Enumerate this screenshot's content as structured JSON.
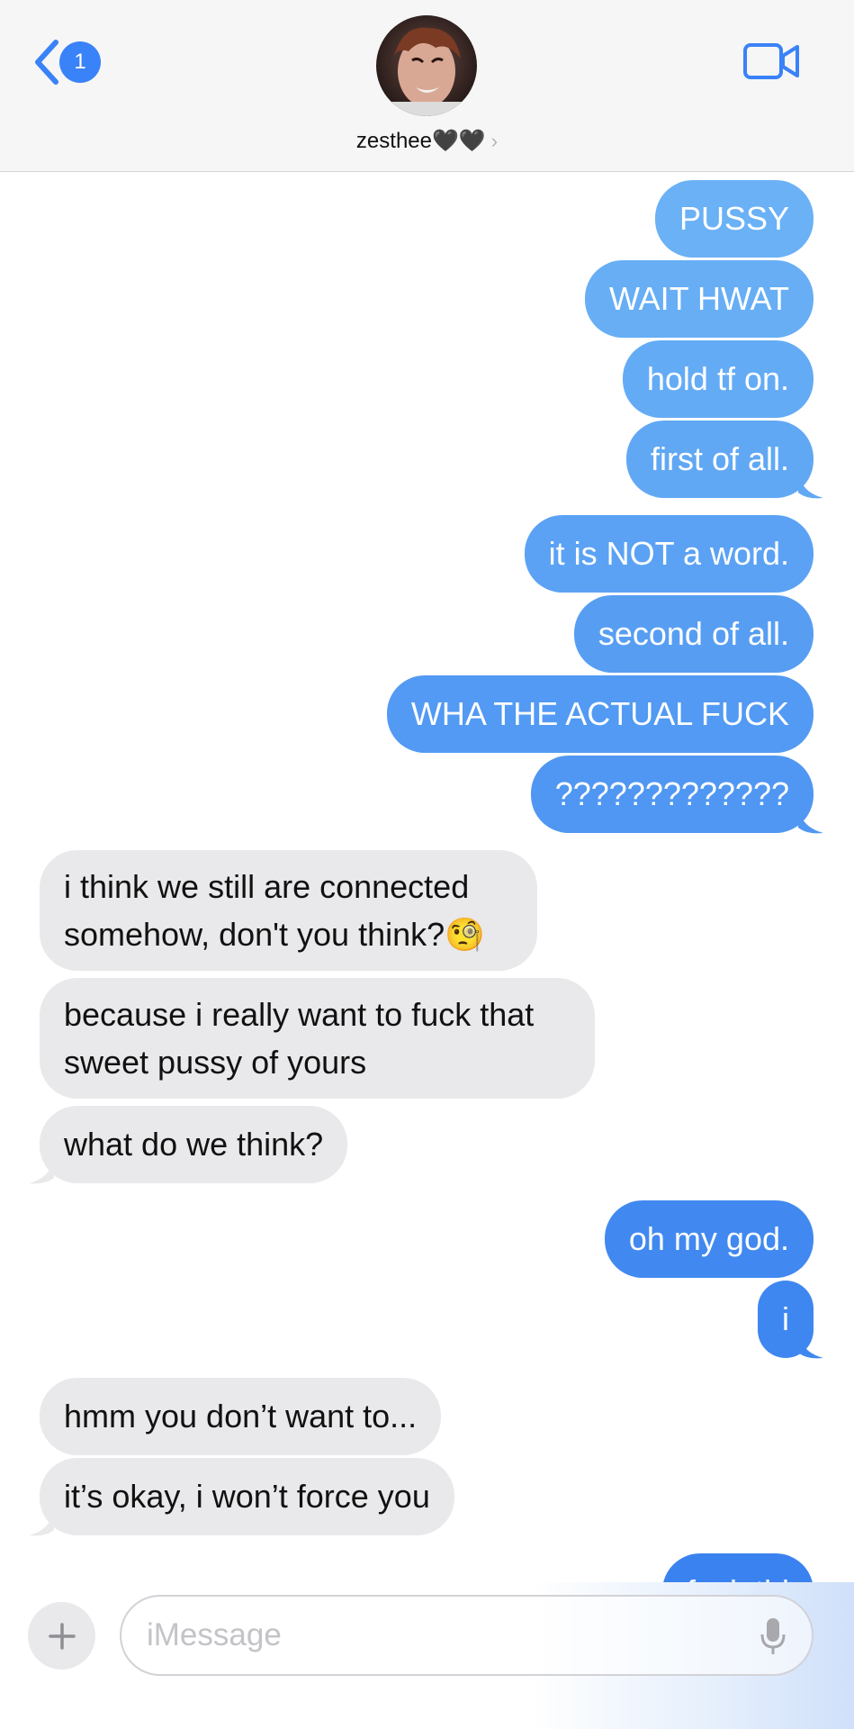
{
  "header": {
    "back_badge": "1",
    "contact_name": "zesthee🖤🖤",
    "contact_chevron": "›",
    "icons": {
      "back": "chevron-left-icon",
      "video": "video-camera-icon",
      "info": "chevron-right-icon"
    }
  },
  "messages": [
    {
      "side": "sent",
      "text": "PUSSY"
    },
    {
      "side": "sent",
      "text": "WAIT HWAT"
    },
    {
      "side": "sent",
      "text": "hold tf on."
    },
    {
      "side": "sent",
      "text": "first of all."
    },
    {
      "side": "sent",
      "text": "it is NOT a word."
    },
    {
      "side": "sent",
      "text": "second of all."
    },
    {
      "side": "sent",
      "text": "WHA THE ACTUAL FUCK"
    },
    {
      "side": "sent",
      "text": "?????????????"
    },
    {
      "side": "received",
      "text": "i think we still are connected somehow, don't you think?🧐"
    },
    {
      "side": "received",
      "text": "because i really want to fuck that sweet pussy of yours"
    },
    {
      "side": "received",
      "text": "what do we think?"
    },
    {
      "side": "sent",
      "text": "oh my god."
    },
    {
      "side": "sent",
      "text": "i"
    },
    {
      "side": "received",
      "text": "hmm you don’t want to..."
    },
    {
      "side": "received",
      "text": "it’s okay, i won’t force you"
    },
    {
      "side": "sent",
      "text": "fuck thi"
    }
  ],
  "composer": {
    "placeholder": "iMessage",
    "plus_icon": "plus-icon",
    "mic_icon": "microphone-icon"
  },
  "colors": {
    "sent_light": "#6ab0f5",
    "sent_dark": "#3b84f0",
    "received": "#e9e9eb",
    "accent": "#3a82f7"
  }
}
